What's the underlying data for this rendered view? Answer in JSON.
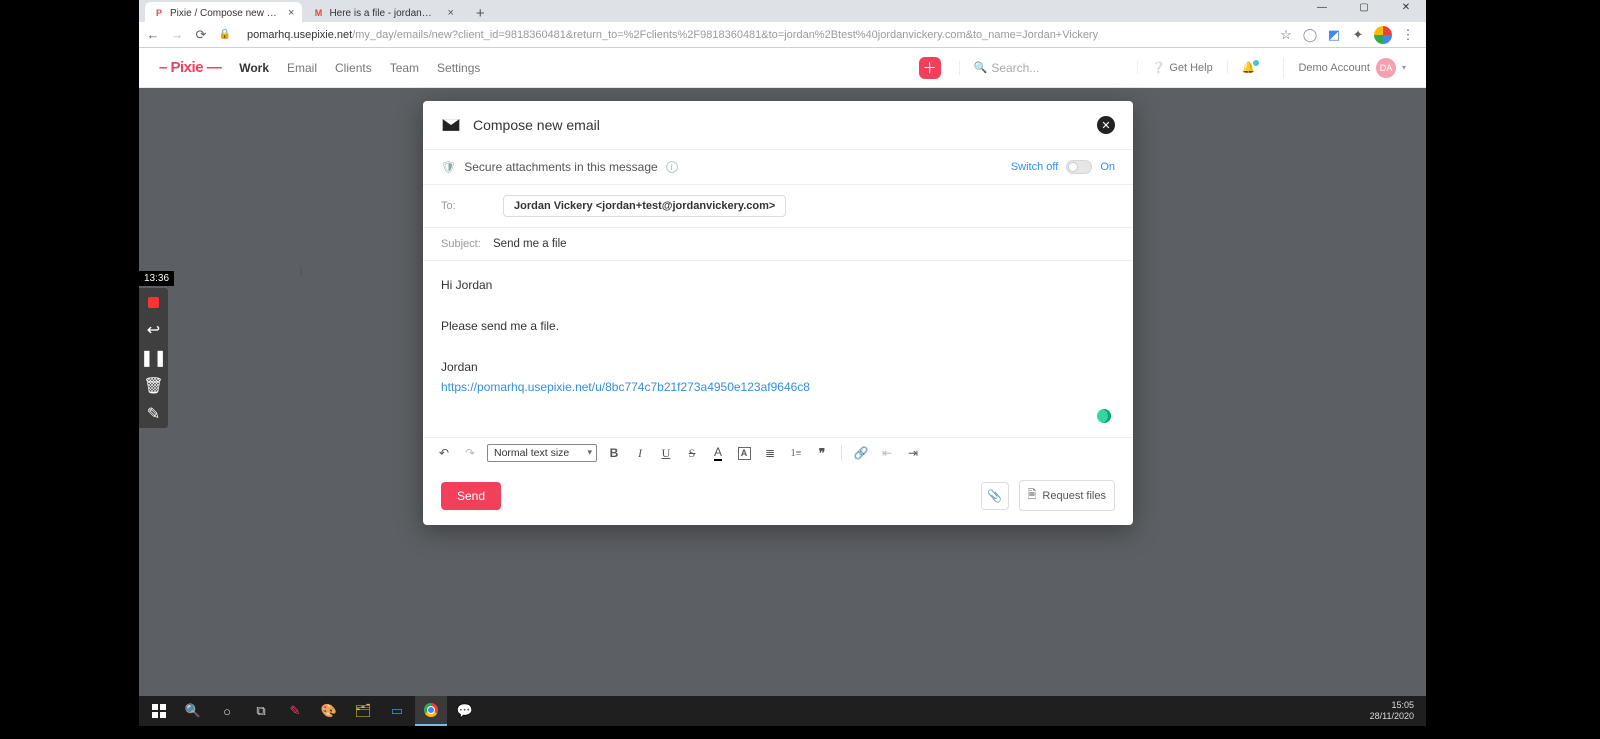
{
  "browser": {
    "tabs": [
      {
        "title": "Pixie / Compose new email",
        "favicon": "P",
        "favcolor": "#f23f5b",
        "active": true
      },
      {
        "title": "Here is a file - jordan@jordanvic",
        "favicon": "M",
        "favcolor": "#ea4335",
        "active": false
      }
    ],
    "url_grey_prefix": "pomarhq.usepixie.net",
    "url_rest": "/my_day/emails/new?client_id=9818360481&return_to=%2Fclients%2F9818360481&to=jordan%2Btest%40jordanvickery.com&to_name=Jordan+Vickery"
  },
  "pixie_header": {
    "logo": "– Pixie —",
    "nav": [
      "Work",
      "Email",
      "Clients",
      "Team",
      "Settings"
    ],
    "active_nav_index": 0,
    "search_placeholder": "Search...",
    "help": "Get Help",
    "account_name": "Demo Account",
    "account_initials": "DA"
  },
  "compose": {
    "title": "Compose new email",
    "secure_label": "Secure attachments in this message",
    "toggle_off": "Switch off",
    "toggle_on": "On",
    "to_label": "To:",
    "to_chip": "Jordan Vickery <jordan+test@jordanvickery.com>",
    "subject_label": "Subject:",
    "subject_value": "Send me a file",
    "body_lines": {
      "greeting": "Hi Jordan",
      "ask": "Please send me a file.",
      "sig": "Jordan",
      "link": "https://pomarhq.usepixie.net/u/8bc774c7b21f273a4950e123af9646c8"
    },
    "text_size": "Normal text size",
    "send": "Send",
    "request_files": "Request files"
  },
  "recorder": {
    "timer": "13:36"
  },
  "taskbar": {
    "time": "15:05",
    "date": "28/11/2020"
  }
}
